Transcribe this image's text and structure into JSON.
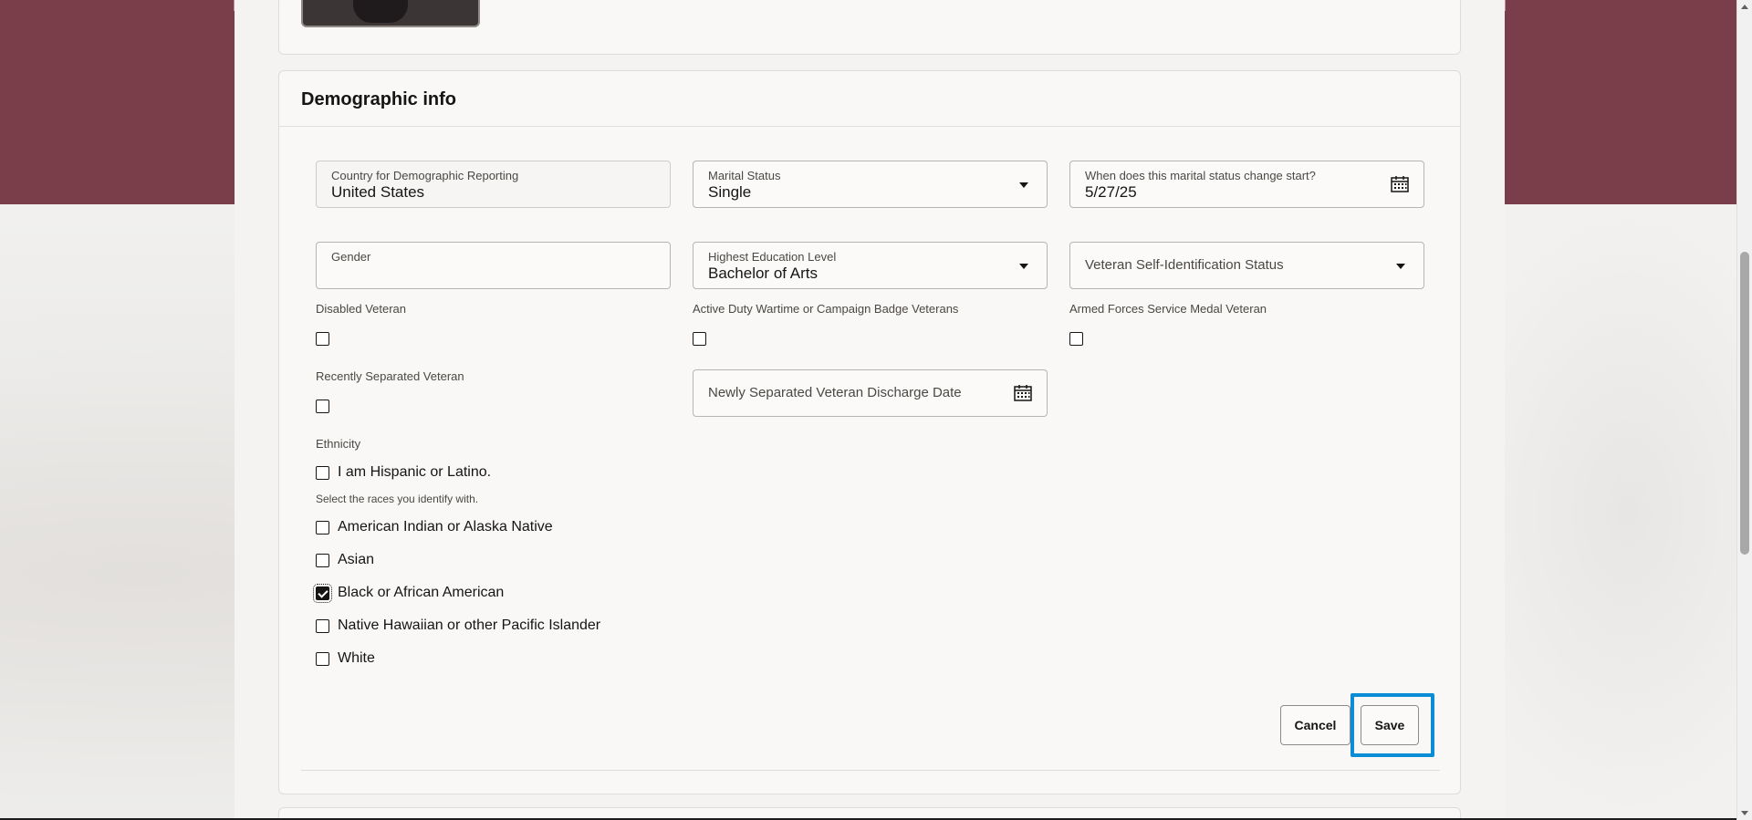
{
  "section": {
    "title": "Demographic info"
  },
  "fields": {
    "country_label": "Country for Demographic Reporting",
    "country_value": "United States",
    "marital_label": "Marital Status",
    "marital_value": "Single",
    "marital_start_label": "When does this marital status change start?",
    "marital_start_value": "5/27/25",
    "gender_label": "Gender",
    "gender_value": "",
    "education_label": "Highest Education Level",
    "education_value": "Bachelor of Arts",
    "veteran_status_placeholder": "Veteran Self-Identification Status",
    "discharge_date_placeholder": "Newly Separated Veteran Discharge Date"
  },
  "veteran_checkboxes": {
    "disabled_veteran": {
      "label": "Disabled Veteran",
      "checked": false
    },
    "active_duty": {
      "label": "Active Duty Wartime or Campaign Badge Veterans",
      "checked": false
    },
    "armed_forces_medal": {
      "label": "Armed Forces Service Medal Veteran",
      "checked": false
    },
    "recently_separated": {
      "label": "Recently Separated Veteran",
      "checked": false
    }
  },
  "ethnicity": {
    "label": "Ethnicity",
    "hispanic": {
      "label": "I am Hispanic or Latino.",
      "checked": false
    },
    "races_prompt": "Select the races you identify with.",
    "races": [
      {
        "label": "American Indian or Alaska Native",
        "checked": false
      },
      {
        "label": "Asian",
        "checked": false
      },
      {
        "label": "Black or African American",
        "checked": true
      },
      {
        "label": "Native Hawaiian or other Pacific Islander",
        "checked": false
      },
      {
        "label": "White",
        "checked": false
      }
    ]
  },
  "actions": {
    "cancel_label": "Cancel",
    "save_label": "Save"
  },
  "colors": {
    "banner": "#7a3e4b",
    "highlight": "#0b8dd6",
    "card_bg": "#f9f8f6"
  }
}
